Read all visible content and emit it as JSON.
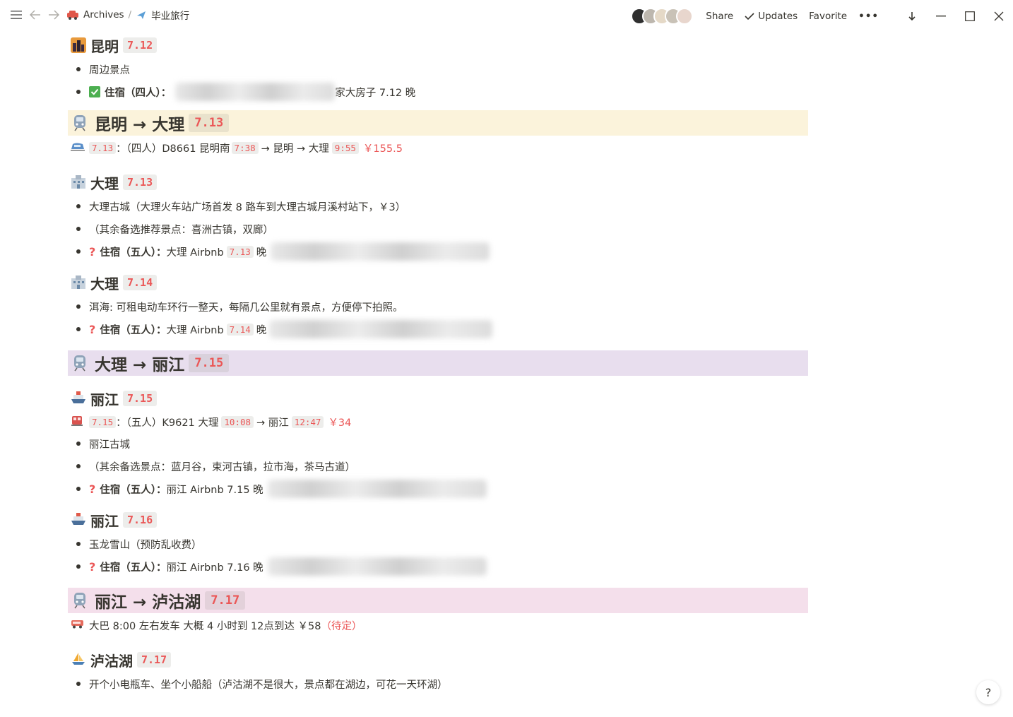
{
  "breadcrumb": {
    "items": [
      "Archives",
      "毕业旅行"
    ],
    "sep": "/"
  },
  "topbar": {
    "share": "Share",
    "updates": "Updates",
    "favorite": "Favorite",
    "more": "•••"
  },
  "sections": {
    "s1": {
      "title": "昆明",
      "date": "7.12",
      "b1": "周边景点",
      "b2_label": "住宿（四人）：",
      "b2_text": "家大房子 7.12 晚"
    },
    "s2": {
      "title": "昆明 → 大理",
      "date": "7.13",
      "train_date": "7.13",
      "train_desc": "：（四人）D8661 昆明南",
      "t1": "7:38",
      "mid": "→ 昆明 → 大理",
      "t2": "9:55",
      "price": "￥155.5"
    },
    "s3": {
      "title": "大理",
      "date": "7.13",
      "b1": "大理古城（大理火车站广场首发 8 路车到大理古城月溪村站下，￥3）",
      "b2": "（其余备选推荐景点：喜洲古镇，双廊）",
      "b3_label": "住宿（五人）：",
      "b3_text": "大理 Airbnb",
      "b3_date": "7.13",
      "b3_after": "晚"
    },
    "s4": {
      "title": "大理",
      "date": "7.14",
      "b1": "洱海: 可租电动车环行一整天，每隔几公里就有景点，方便停下拍照。",
      "b2_label": "住宿（五人）：",
      "b2_text": "大理 Airbnb",
      "b2_date": "7.14",
      "b2_after": "晚"
    },
    "s5": {
      "title": "大理 → 丽江",
      "date": "7.15"
    },
    "s6": {
      "title": "丽江",
      "date": "7.15",
      "train_date": "7.15",
      "train_desc": "：（五人）K9621 大理",
      "t1": "10:08",
      "mid": "→ 丽江",
      "t2": "12:47",
      "price": "￥34",
      "b1": "丽江古城",
      "b2": "（其余备选景点：蓝月谷，束河古镇，拉市海，茶马古道）",
      "b3_label": "住宿（五人）：",
      "b3_text": "丽江 Airbnb 7.15 晚"
    },
    "s7": {
      "title": "丽江",
      "date": "7.16",
      "b1": "玉龙雪山（预防乱收费）",
      "b2_label": "住宿（五人）：",
      "b2_text": "丽江 Airbnb 7.16 晚"
    },
    "s8": {
      "title": "丽江 → 泸沽湖",
      "date": "7.17",
      "bus_text": "大巴 8:00 左右发车 大概 4 小时到 12点到达 ￥58",
      "bus_note": "（待定）"
    },
    "s9": {
      "title": "泸沽湖",
      "date": "7.17",
      "b1": "开个小电瓶车、坐个小船船（泸沽湖不是很大，景点都在湖边，可花一天环湖）"
    }
  },
  "help": "?"
}
